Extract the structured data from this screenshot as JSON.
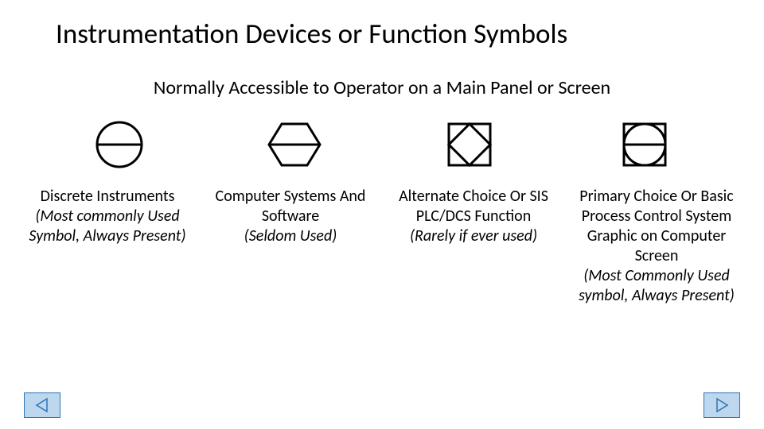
{
  "title": "Instrumentation Devices or Function Symbols",
  "subtitle": "Normally Accessible to Operator on a Main Panel or Screen",
  "items": [
    {
      "label_main": "Discrete Instruments",
      "label_note": "(Most commonly Used Symbol, Always Present)"
    },
    {
      "label_main": "Computer Systems And Software",
      "label_note": "(Seldom Used)"
    },
    {
      "label_main": "Alternate Choice Or SIS PLC/DCS Function",
      "label_note": "(Rarely if ever used)"
    },
    {
      "label_main": "Primary Choice Or Basic Process Control System Graphic on Computer Screen",
      "label_note": "(Most Commonly Used symbol, Always Present)"
    }
  ],
  "nav": {
    "prev": "Previous",
    "next": "Next"
  }
}
